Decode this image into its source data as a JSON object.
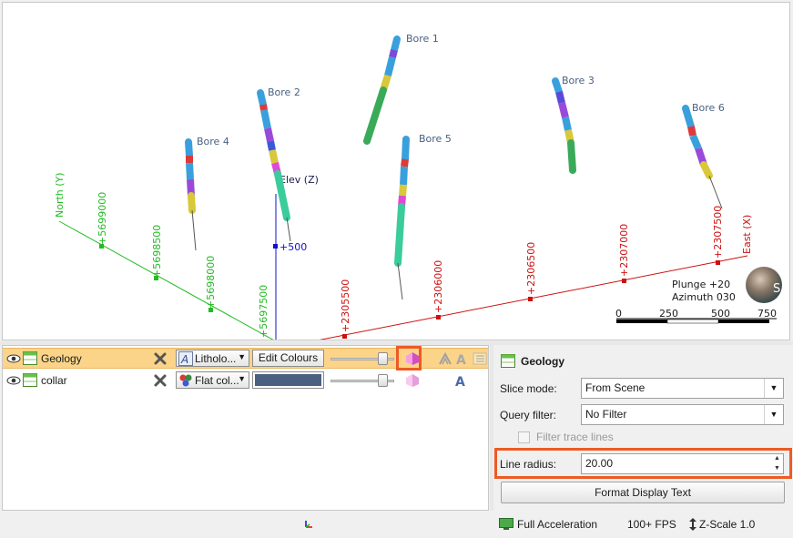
{
  "scene": {
    "bores": [
      {
        "label": "Bore 1"
      },
      {
        "label": "Bore 2"
      },
      {
        "label": "Bore 3"
      },
      {
        "label": "Bore 4"
      },
      {
        "label": "Bore 5"
      },
      {
        "label": "Bore 6"
      }
    ],
    "axes": {
      "north_label": "North (Y)",
      "north_ticks": [
        "+5699000",
        "+5698500",
        "+5698000",
        "+5697500"
      ],
      "east_label": "East (X)",
      "east_ticks": [
        "+2305500",
        "+2306000",
        "+2306500",
        "+2307000",
        "+2307500"
      ],
      "elev_label": "Elev (Z)",
      "elev_ticks": [
        "+500"
      ],
      "north_color": "#22bb22",
      "east_color": "#cc1111",
      "elev_color": "#1111cc"
    },
    "view": {
      "plunge": "Plunge +20",
      "azimuth": "Azimuth 030"
    },
    "scale_bar": [
      "0",
      "250",
      "500",
      "750"
    ],
    "compass_letter": "S"
  },
  "layers": [
    {
      "name": "Geology",
      "style": "Litholo...",
      "action": "Edit Colours",
      "selected": true,
      "slider": 0.85
    },
    {
      "name": "collar",
      "style": "Flat col...",
      "color": "#4a6080",
      "selected": false,
      "slider": 0.85
    }
  ],
  "properties": {
    "title": "Geology",
    "slice_mode_label": "Slice mode:",
    "slice_mode_value": "From Scene",
    "query_filter_label": "Query filter:",
    "query_filter_value": "No Filter",
    "filter_trace_label": "Filter trace lines",
    "line_radius_label": "Line radius:",
    "line_radius_value": "20.00",
    "format_button": "Format Display Text"
  },
  "status": {
    "acceleration": "Full Acceleration",
    "fps": "100+ FPS",
    "zscale": "Z-Scale 1.0"
  },
  "colors": {
    "selected_row": "#fbd48a",
    "highlight": "#ee5a24"
  }
}
